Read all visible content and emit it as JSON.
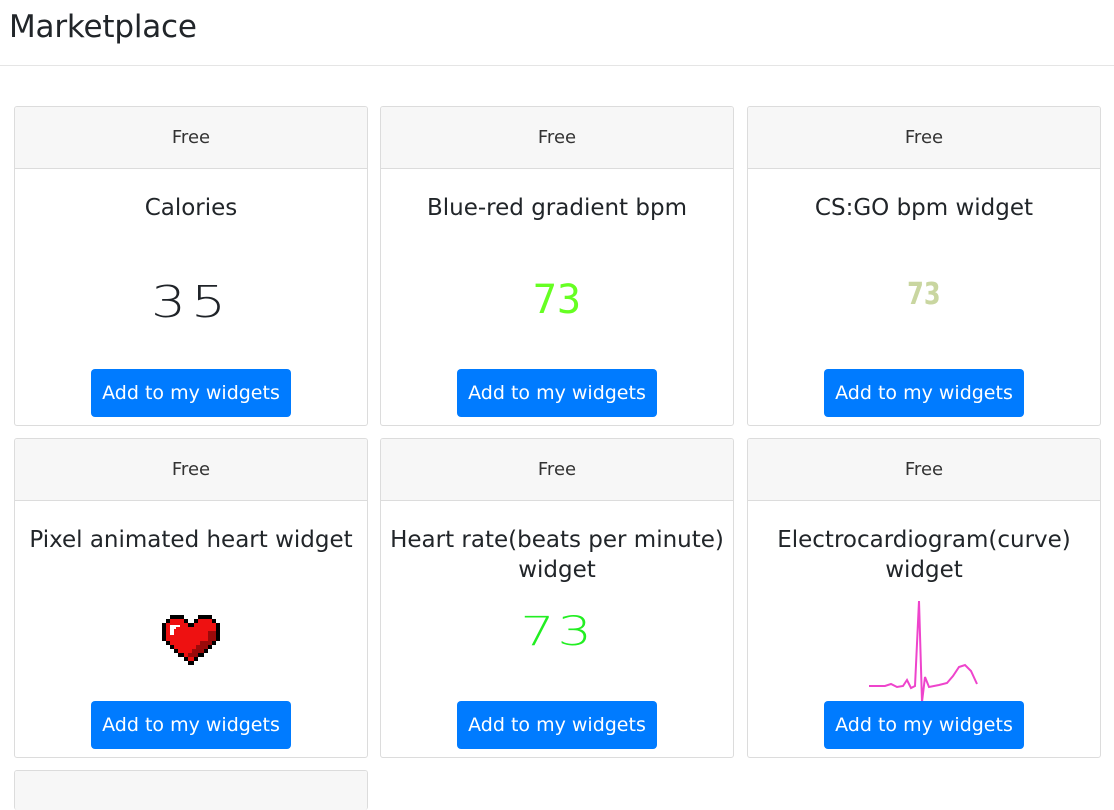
{
  "page": {
    "title": "Marketplace"
  },
  "colors": {
    "button": "#007bff",
    "calories_number": "#1f2328",
    "gradient_bpm_number": "#66ff22",
    "csgo_number": "#c9d6a0",
    "heart_rate_number": "#22ee22",
    "ecg_curve": "#ee44cc",
    "pixel_heart": "#ee1111"
  },
  "cards": [
    {
      "price": "Free",
      "title": "Calories",
      "preview_value": "35",
      "button": "Add to my widgets"
    },
    {
      "price": "Free",
      "title": "Blue-red gradient bpm",
      "preview_value": "73",
      "button": "Add to my widgets"
    },
    {
      "price": "Free",
      "title": "CS:GO bpm widget",
      "preview_value": "73",
      "button": "Add to my widgets"
    },
    {
      "price": "Free",
      "title": "Pixel animated heart widget",
      "preview_icon": "pixel-heart-icon",
      "button": "Add to my widgets"
    },
    {
      "price": "Free",
      "title": "Heart rate(beats per minute) widget",
      "preview_value": "73",
      "button": "Add to my widgets"
    },
    {
      "price": "Free",
      "title": "Electrocardiogram(curve) widget",
      "preview_icon": "ecg-curve-icon",
      "button": "Add to my widgets"
    }
  ]
}
